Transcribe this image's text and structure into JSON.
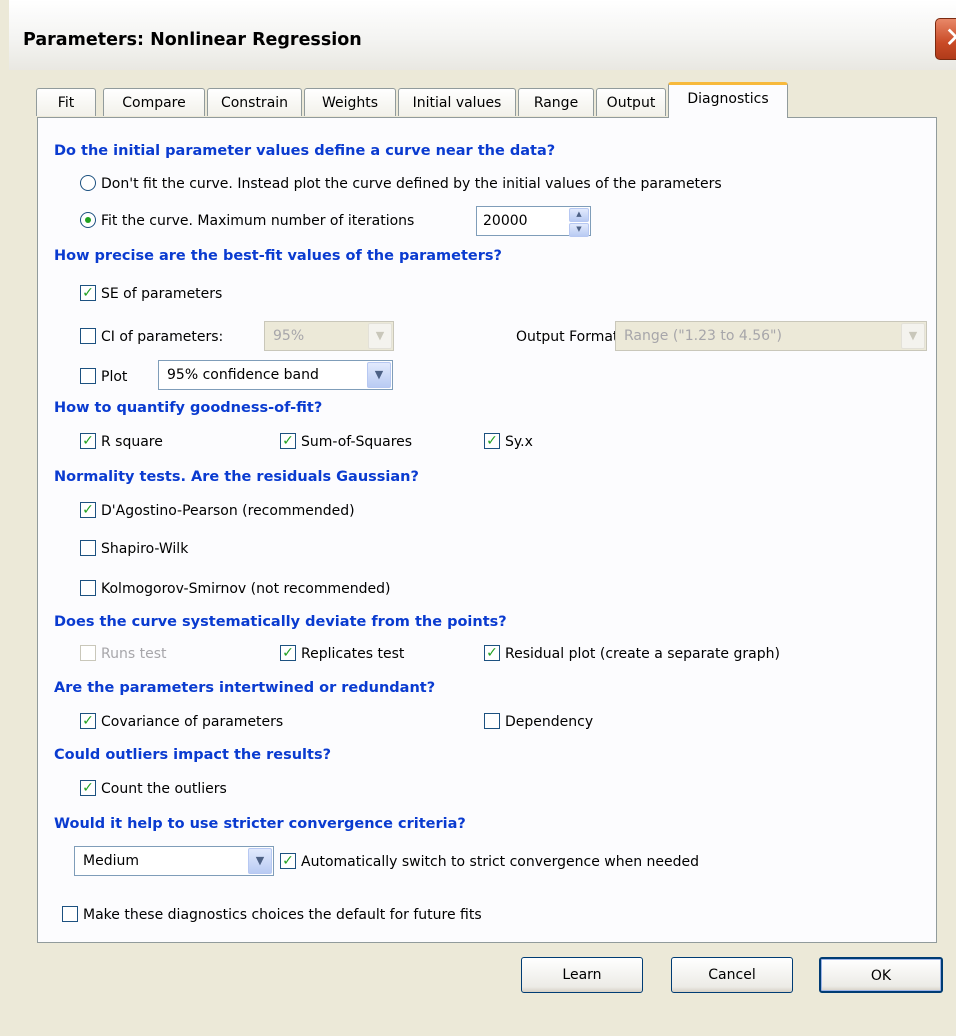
{
  "window": {
    "title": "Parameters: Nonlinear Regression",
    "close_glyph": "✕"
  },
  "tabs": [
    {
      "label": "Fit"
    },
    {
      "label": "Compare"
    },
    {
      "label": "Constrain"
    },
    {
      "label": "Weights"
    },
    {
      "label": "Initial values"
    },
    {
      "label": "Range"
    },
    {
      "label": "Output"
    },
    {
      "label": "Diagnostics",
      "active": true
    }
  ],
  "sections": {
    "initial": {
      "heading": "Do the initial parameter values define a curve near the data?",
      "dont_fit_label": "Don't fit the curve. Instead plot the curve defined by the initial values of the parameters",
      "fit_label": "Fit the curve. Maximum number of iterations",
      "max_iterations": "20000",
      "selected": "fit"
    },
    "precision": {
      "heading": "How precise are the best-fit values of the parameters?",
      "se_label": "SE of parameters",
      "ci_label": "CI of parameters:",
      "ci_value": "95%",
      "output_format_label": "Output Format:",
      "output_format_value": "Range (\"1.23 to 4.56\")",
      "plot_label": "Plot",
      "plot_value": "95% confidence band"
    },
    "goodness": {
      "heading": "How to quantify goodness-of-fit?",
      "r_square": "R square",
      "sum_of_squares": "Sum-of-Squares",
      "syx": "Sy.x"
    },
    "normality": {
      "heading": "Normality tests. Are the residuals Gaussian?",
      "dagostino": "D'Agostino-Pearson (recommended)",
      "shapiro": "Shapiro-Wilk",
      "kolmogorov": "Kolmogorov-Smirnov (not recommended)"
    },
    "deviation": {
      "heading": "Does the curve systematically deviate from the points?",
      "runs_test": "Runs test",
      "replicates_test": "Replicates test",
      "residual_plot": "Residual plot (create a separate graph)"
    },
    "intertwined": {
      "heading": "Are the parameters intertwined or redundant?",
      "covariance": "Covariance of parameters",
      "dependency": "Dependency"
    },
    "outliers": {
      "heading": "Could outliers impact the results?",
      "count_outliers": "Count the outliers"
    },
    "convergence": {
      "heading": "Would it help to use stricter convergence criteria?",
      "criteria_value": "Medium",
      "auto_switch": "Automatically switch to strict convergence when needed"
    },
    "default_choice": "Make these diagnostics choices the default for future fits"
  },
  "checks": {
    "se": true,
    "ci": false,
    "plot": false,
    "r_square": true,
    "sum_of_squares": true,
    "syx": true,
    "dagostino": true,
    "shapiro": false,
    "kolmogorov": false,
    "runs_test": false,
    "replicates_test": true,
    "residual_plot": true,
    "covariance": true,
    "dependency": false,
    "count_outliers": true,
    "auto_switch": true,
    "make_default": false
  },
  "buttons": {
    "learn": "Learn",
    "cancel": "Cancel",
    "ok": "OK"
  },
  "glyphs": {
    "check": "✓",
    "dropdown": "▼",
    "spin_up": "▲",
    "spin_down": "▼"
  },
  "colors": {
    "heading": "#0a3bd0",
    "check_mark": "#21a121",
    "dialog_bg": "#ece9d8",
    "panel_bg": "#fcfcfe",
    "active_tab_accent": "#f7b93c",
    "close_button": "#c94a26"
  }
}
